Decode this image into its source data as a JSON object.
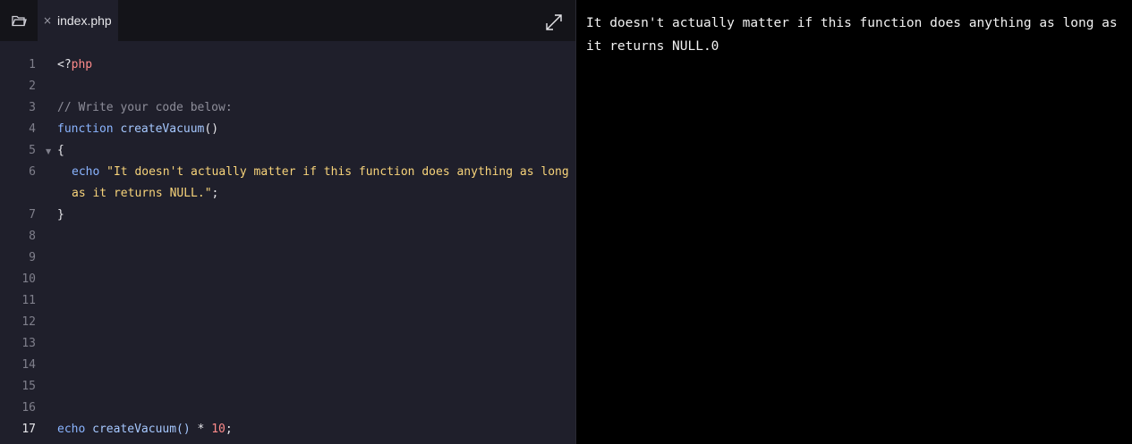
{
  "editor": {
    "tab": {
      "filename": "index.php",
      "close_icon": "×"
    },
    "line_numbers": [
      "1",
      "2",
      "3",
      "4",
      "5",
      "6",
      "7",
      "8",
      "9",
      "10",
      "11",
      "12",
      "13",
      "14",
      "15",
      "16",
      "17"
    ],
    "code": {
      "l1_open": "<?",
      "l1_php": "php",
      "l3_comment": "// Write your code below:",
      "l4_keyword": "function",
      "l4_name": "createVacuum",
      "l4_parens": "()",
      "l5_brace": "{",
      "l6_echo": "echo",
      "l6_string_a": "\"It doesn't actually matter if this function does anything as long",
      "l6_string_b": "as it returns NULL.\"",
      "l6_semicolon": ";",
      "l7_brace": "}",
      "l17_echo": "echo",
      "l17_call": "createVacuum()",
      "l17_op": " * ",
      "l17_num": "10",
      "l17_semicolon": ";"
    },
    "fold_marker": "▼"
  },
  "output": {
    "text": "It doesn't actually matter if this function does anything as long as it returns NULL.0"
  },
  "colors": {
    "editor_bg": "#1f1f2b",
    "tabbar_bg": "#141419",
    "output_bg": "#000000",
    "keyword": "#8ab4ff",
    "string": "#f7d37a",
    "number": "#ff8b8b",
    "comment": "#8e8e9a"
  }
}
